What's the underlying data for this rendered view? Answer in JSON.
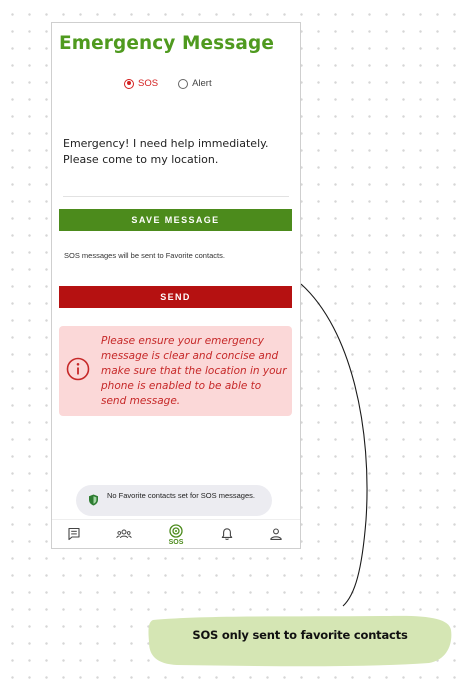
{
  "screen": {
    "title": "Emergency Message"
  },
  "message_type": {
    "options": [
      {
        "label": "SOS",
        "selected": true
      },
      {
        "label": "Alert",
        "selected": false
      }
    ]
  },
  "message": {
    "text": "Emergency! I need help immediately.\nPlease come to my location."
  },
  "buttons": {
    "save_label": "SAVE MESSAGE",
    "send_label": "SEND"
  },
  "info": {
    "text": "SOS messages will be sent to Favorite contacts."
  },
  "warning": {
    "text": "Please ensure your emergency message is clear and concise and make sure that the location in your phone is enabled to be able to send message.",
    "icon": "info-circle-icon"
  },
  "toast": {
    "text": "No Favorite contacts set for SOS messages.",
    "icon": "shield-icon"
  },
  "tab_bar": {
    "tabs": [
      {
        "icon": "messages-icon",
        "label": "",
        "active": false
      },
      {
        "icon": "contacts-icon",
        "label": "",
        "active": false
      },
      {
        "icon": "sos-icon",
        "label": "SOS",
        "active": true
      },
      {
        "icon": "bell-icon",
        "label": "",
        "active": false
      },
      {
        "icon": "profile-icon",
        "label": "",
        "active": false
      }
    ]
  },
  "annotation": {
    "text": "SOS only sent to favorite contacts"
  },
  "colors": {
    "brand_green": "#4f9a1f",
    "save_green": "#4c8b1c",
    "send_red": "#b51111",
    "warning_bg": "#fbd8d8",
    "warning_text": "#c62828",
    "annotation_bg": "#d5e6b4"
  }
}
